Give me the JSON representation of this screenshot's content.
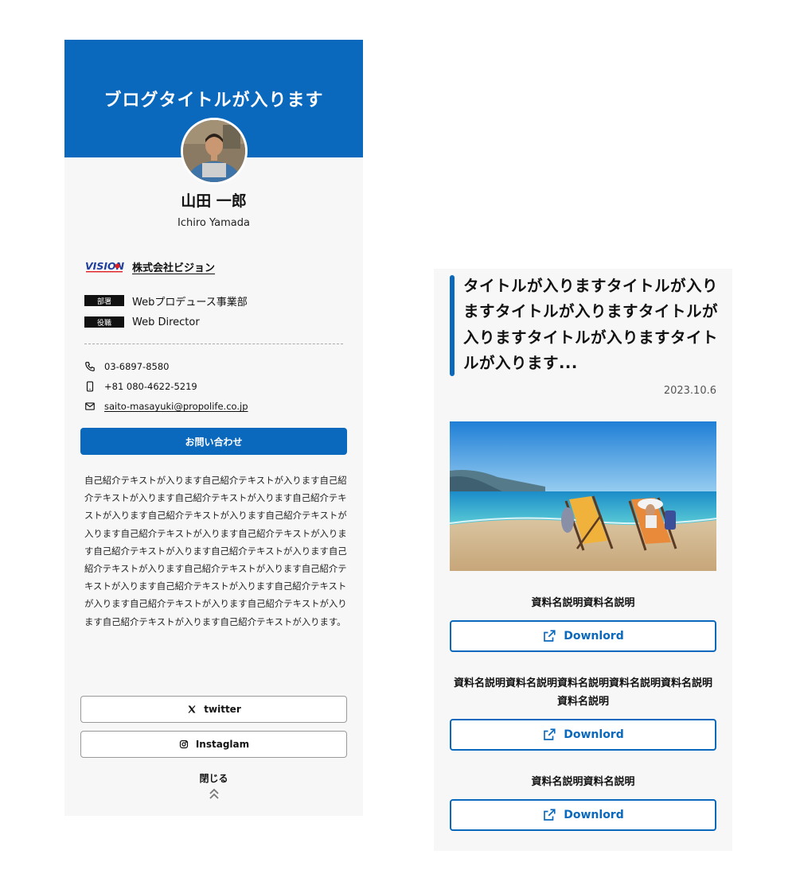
{
  "profile": {
    "blog_title": "ブログタイトルが入ります",
    "name": "山田 一郎",
    "name_en": "Ichiro Yamada",
    "company_logo_text": "VISION",
    "company": "株式会社ビジョン",
    "department_tag": "部署",
    "department": "Webプロデュース事業部",
    "role_tag": "役職",
    "role": "Web Director",
    "phone": "03-6897-8580",
    "mobile": "+81 080-4622-5219",
    "email": "saito-masayuki@propolife.co.jp",
    "contact_button": "お問い合わせ",
    "intro": "自己紹介テキストが入ります自己紹介テキストが入ります自己紹介テキストが入ります自己紹介テキストが入ります自己紹介テキストが入ります自己紹介テキストが入ります自己紹介テキストが入ります自己紹介テキストが入ります自己紹介テキストが入ります自己紹介テキストが入ります自己紹介テキストが入ります自己紹介テキストが入ります自己紹介テキストが入ります自己紹介テキストが入ります自己紹介テキストが入ります自己紹介テキストが入ります自己紹介テキストが入ります自己紹介テキストが入ります自己紹介テキストが入ります自己紹介テキストが入ります。",
    "twitter_label": "twitter",
    "instagram_label": "Instaglam",
    "close_label": "閉じる",
    "accent_color": "#0a68bd"
  },
  "article": {
    "title": "タイトルが入りますタイトルが入りますタイトルが入りますタイトルが入りますタイトルが入りますタイトルが入ります...",
    "date": "2023.10.6",
    "image": "beach-deckchairs-photo",
    "documents": [
      {
        "label": "資料名説明資料名説明",
        "button": "Downlord"
      },
      {
        "label": "資料名説明資料名説明資料名説明資料名説明資料名説明資料名説明",
        "button": "Downlord"
      },
      {
        "label": "資料名説明資料名説明",
        "button": "Downlord"
      }
    ]
  },
  "icons": {
    "phone": "phone-icon",
    "mobile": "smartphone-icon",
    "email": "mail-icon",
    "twitter": "x-logo-icon",
    "instagram": "instagram-icon",
    "close": "double-chevron-up-icon",
    "download": "external-link-icon"
  }
}
